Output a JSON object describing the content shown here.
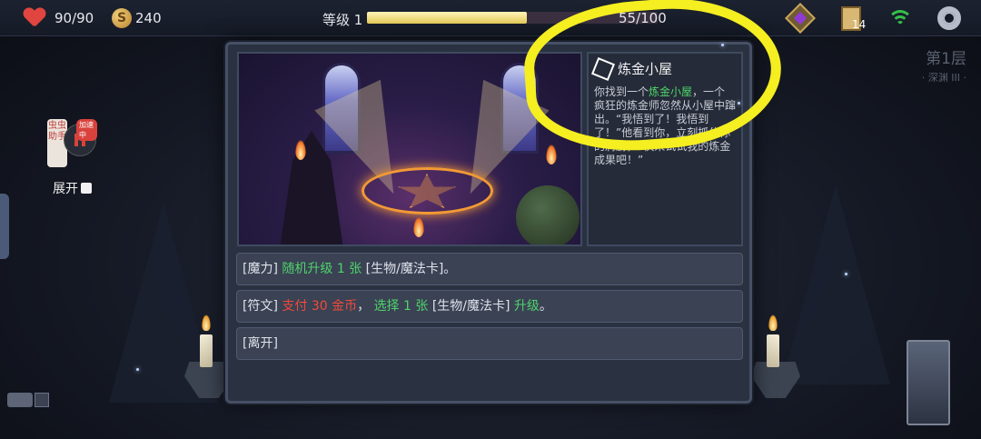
{
  "topbar": {
    "hp": "90/90",
    "gold": "240",
    "coin_symbol": "S",
    "level_label": "等级 1",
    "xp_text": "55/100",
    "xp_fraction": 0.55,
    "deck_count": "14",
    "icons": [
      "heart-icon",
      "coin-icon",
      "d20-icon",
      "deck-icon",
      "wifi-icon",
      "gear-icon"
    ]
  },
  "floor": {
    "title": "第1层",
    "subtitle": "· 深渊 III ·"
  },
  "assistant": {
    "card_text": "虫虫助手",
    "badge": "加速中",
    "expand_label": "展开"
  },
  "event": {
    "title": "炼金小屋",
    "desc_1": "你找到一个",
    "desc_hl": "炼金小屋",
    "desc_2": "，一个疯狂的炼金师忽然从小屋中蹿出。“我悟到了！我悟到了！”他看到你，立刻抓住你的肩膀，“快来试试我的炼金成果吧！”"
  },
  "options": [
    {
      "tag": "[魔力]",
      "action": "随机升级 1 张",
      "rest": "[生物/魔法卡]",
      "tail": "。"
    },
    {
      "tag": "[符文]",
      "cost": "支付 30 金币",
      "sep": "，",
      "action": "选择 1 张",
      "rest": "[生物/魔法卡]",
      "upgrade": "升级",
      "tail": "。"
    },
    {
      "tag": "[离开]"
    }
  ],
  "colors": {
    "annotation": "#f5ee20",
    "green": "#4fd36a",
    "red": "#f04a3a",
    "xp": "#e6cd5b"
  }
}
